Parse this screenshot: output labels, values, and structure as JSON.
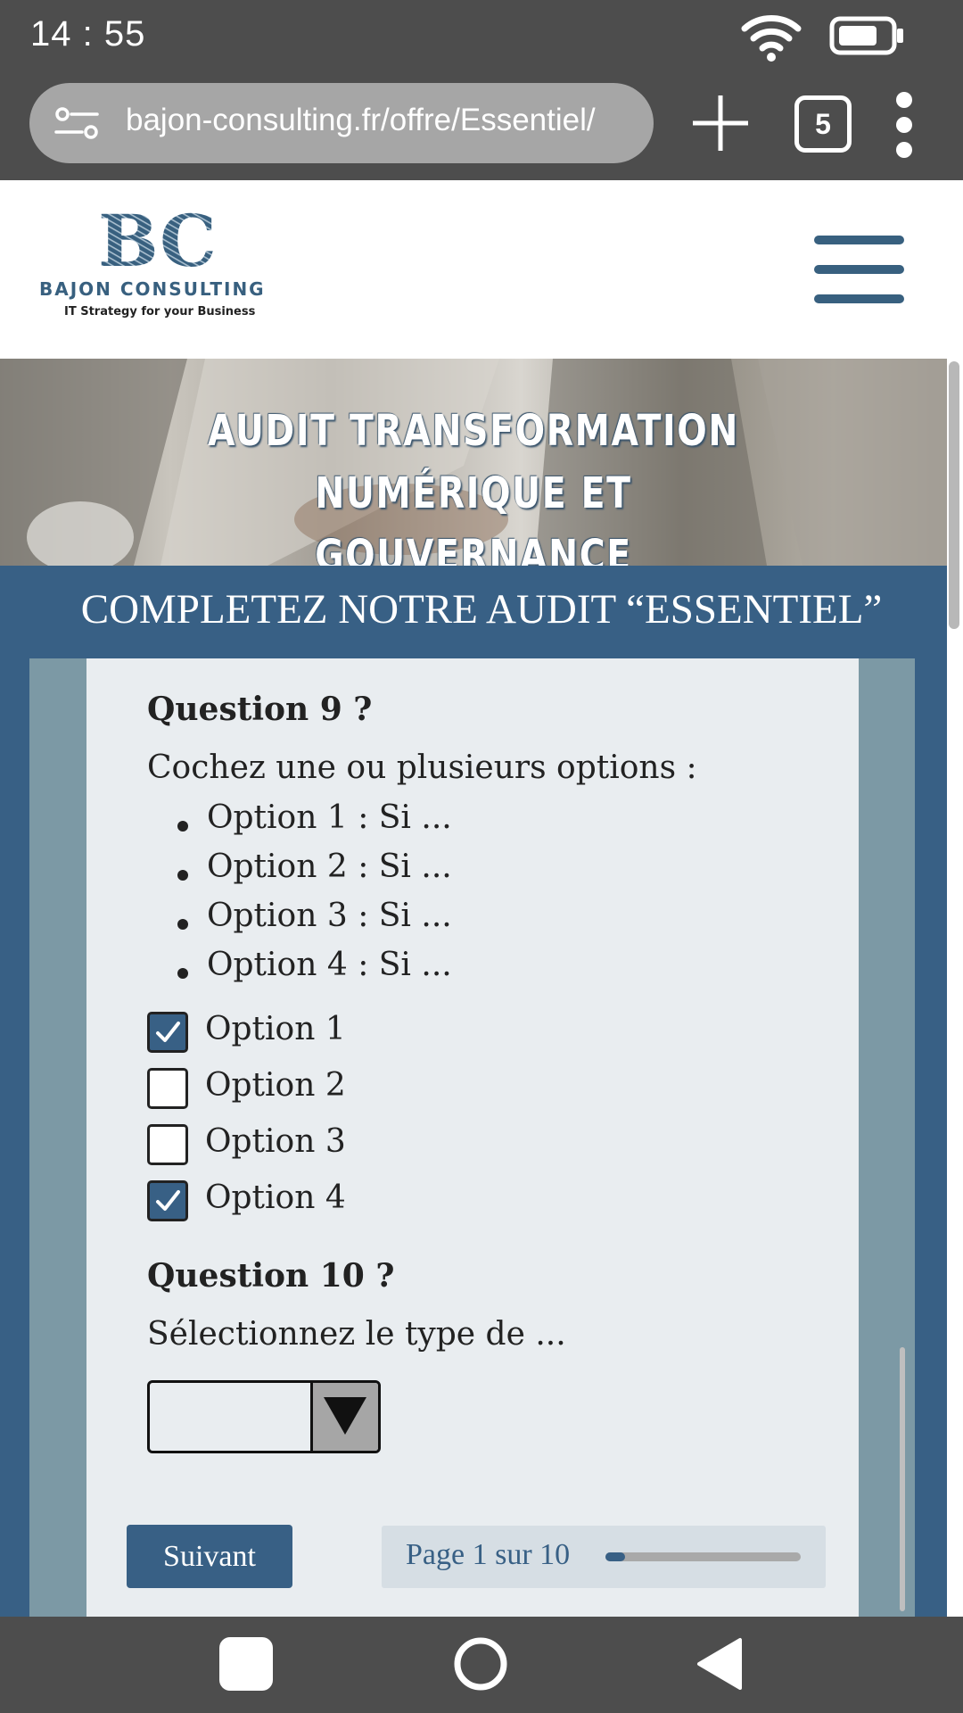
{
  "status_bar": {
    "time": "14 : 55"
  },
  "browser": {
    "url": "bajon-consulting.fr/offre/Essentiel/",
    "tab_count": "5"
  },
  "site": {
    "logo": {
      "monogram": "BC",
      "name": "BAJON CONSULTING",
      "tagline": "IT Strategy for your Business"
    },
    "hero_title_line1": "AUDIT TRANSFORMATION NUMÉRIQUE ET",
    "hero_title_line2": "GOUVERNANCE",
    "section_title": "COMPLETEZ NOTRE AUDIT “ESSENTIEL”"
  },
  "form": {
    "question9": {
      "title": "Question 9 ?",
      "prompt": "Cochez une ou plusieurs options :",
      "bullets": [
        "Option 1 : Si ...",
        "Option 2 : Si ...",
        "Option 3 : Si ...",
        "Option 4 : Si ..."
      ],
      "options": [
        {
          "label": "Option 1",
          "checked": true
        },
        {
          "label": "Option 2",
          "checked": false
        },
        {
          "label": "Option 3",
          "checked": false
        },
        {
          "label": "Option 4",
          "checked": true
        }
      ]
    },
    "question10": {
      "title": "Question 10 ?",
      "prompt": "Sélectionnez le type de ...",
      "selected_value": ""
    },
    "next_label": "Suivant",
    "progress_text": "Page 1 sur 10",
    "progress_fraction": 0.1
  },
  "colors": {
    "brand": "#386085",
    "panel": "#7c99a5",
    "card": "#e9edf0"
  }
}
